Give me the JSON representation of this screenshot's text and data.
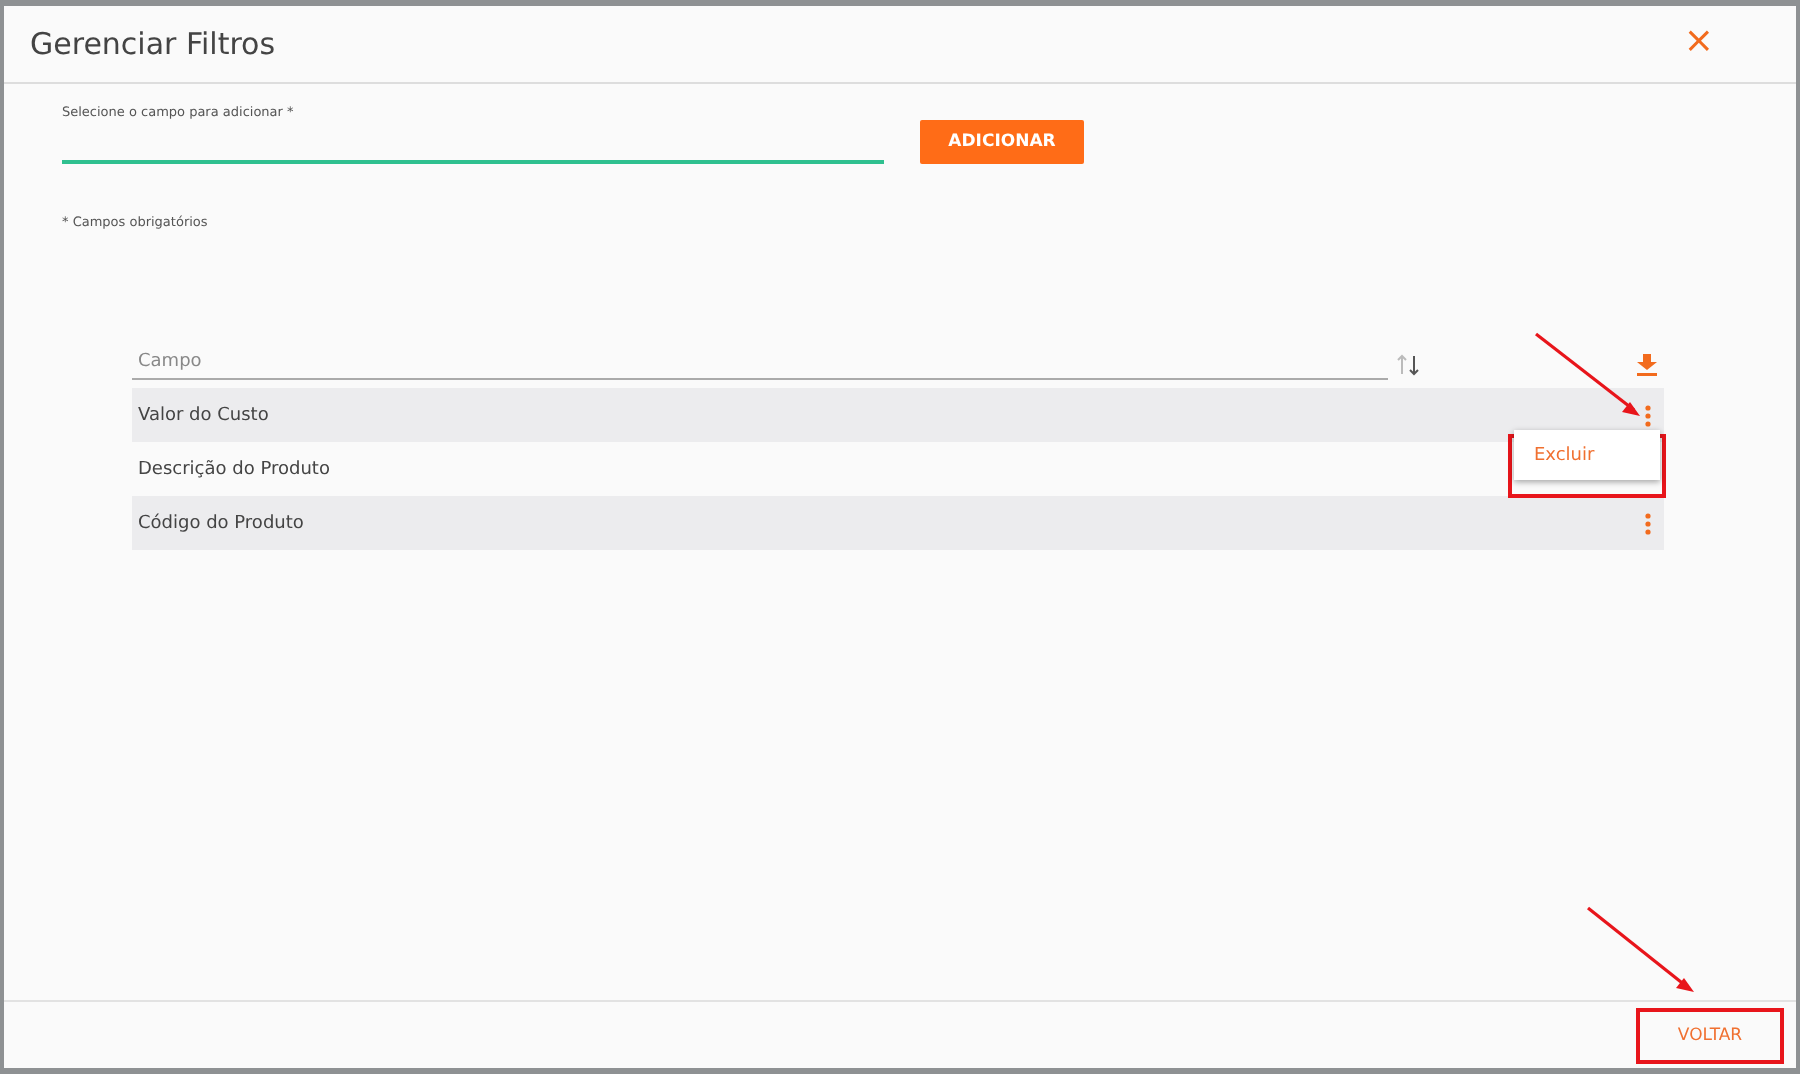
{
  "dialog": {
    "title": "Gerenciar Filtros",
    "close_icon": "×"
  },
  "field": {
    "label": "Selecione o campo para adicionar *"
  },
  "add_button": "ADICIONAR",
  "required_note": "* Campos obrigatórios",
  "table": {
    "column": "Campo",
    "rows": [
      {
        "label": "Valor do Custo",
        "menu_open": true
      },
      {
        "label": "Descrição do Produto",
        "menu_open": false
      },
      {
        "label": "Código do Produto",
        "menu_open": false
      }
    ]
  },
  "context_menu": {
    "items": [
      "Excluir"
    ]
  },
  "footer_button": "VOLTAR"
}
